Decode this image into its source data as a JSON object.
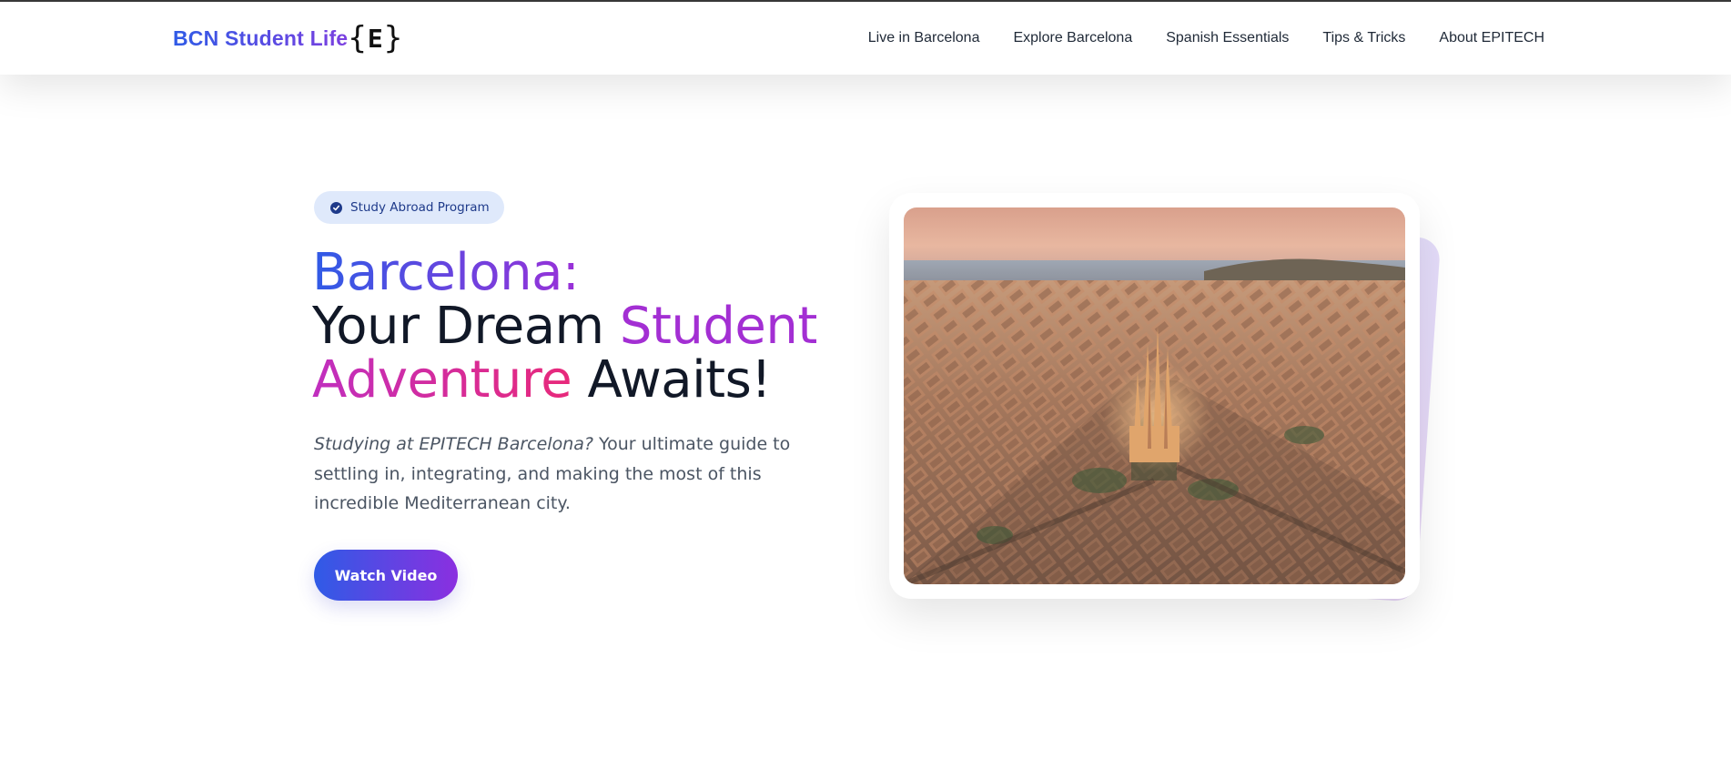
{
  "brand": {
    "name": "BCN Student Life",
    "logo_icon": "epitech-brace-logo-icon"
  },
  "nav": {
    "items": [
      {
        "label": "Live in Barcelona"
      },
      {
        "label": "Explore Barcelona"
      },
      {
        "label": "Spanish Essentials"
      },
      {
        "label": "Tips & Tricks"
      },
      {
        "label": "About EPITECH"
      }
    ]
  },
  "hero": {
    "badge": {
      "label": "Study Abroad Program",
      "icon": "check-circle-icon"
    },
    "headline": {
      "part1": "Barcelona:",
      "part2": "Your Dream ",
      "part3": "Student",
      "part4": "Adventure",
      "part5": " Awaits!"
    },
    "intro": {
      "emphasis": "Studying at EPITECH Barcelona?",
      "body": " Your ultimate guide to settling in, integrating, and making the most of this incredible Mediterranean city."
    },
    "cta": {
      "label": "Watch Video"
    },
    "image_subject": "Aerial view of Barcelona with the Sagrada Familia at sunset"
  },
  "colors": {
    "accent_blue": "#2f5be6",
    "accent_purple": "#a32fd3",
    "accent_pink": "#e8297a",
    "badge_bg": "#dfe9fb",
    "badge_text": "#1e3a8a"
  }
}
